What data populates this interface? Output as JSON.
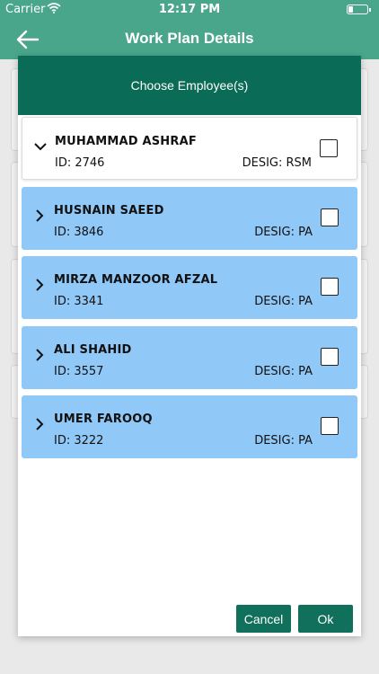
{
  "status_bar": {
    "carrier": "Carrier",
    "time": "12:17 PM",
    "battery_level": 0.2
  },
  "nav": {
    "title": "Work Plan Details",
    "back_icon": "back-arrow-icon"
  },
  "modal": {
    "title": "Choose Employee(s)",
    "employees": [
      {
        "name": "MUHAMMAD ASHRAF",
        "id": "ID: 2746",
        "desig": "DESIG: RSM",
        "expanded": true,
        "checked": false
      },
      {
        "name": "HUSNAIN SAEED",
        "id": "ID: 3846",
        "desig": "DESIG: PA",
        "expanded": false,
        "checked": false
      },
      {
        "name": "MIRZA MANZOOR AFZAL",
        "id": "ID: 3341",
        "desig": "DESIG: PA",
        "expanded": false,
        "checked": false
      },
      {
        "name": "ALI SHAHID",
        "id": "ID: 3557",
        "desig": "DESIG: PA",
        "expanded": false,
        "checked": false
      },
      {
        "name": "UMER FAROOQ",
        "id": "ID: 3222",
        "desig": "DESIG: PA",
        "expanded": false,
        "checked": false
      }
    ],
    "cancel_label": "Cancel",
    "ok_label": "Ok"
  },
  "colors": {
    "nav_bg": "#4aa68a",
    "modal_header_bg": "#0a6b56",
    "row_bg": "#90c8f7",
    "button_bg": "#11705b"
  }
}
